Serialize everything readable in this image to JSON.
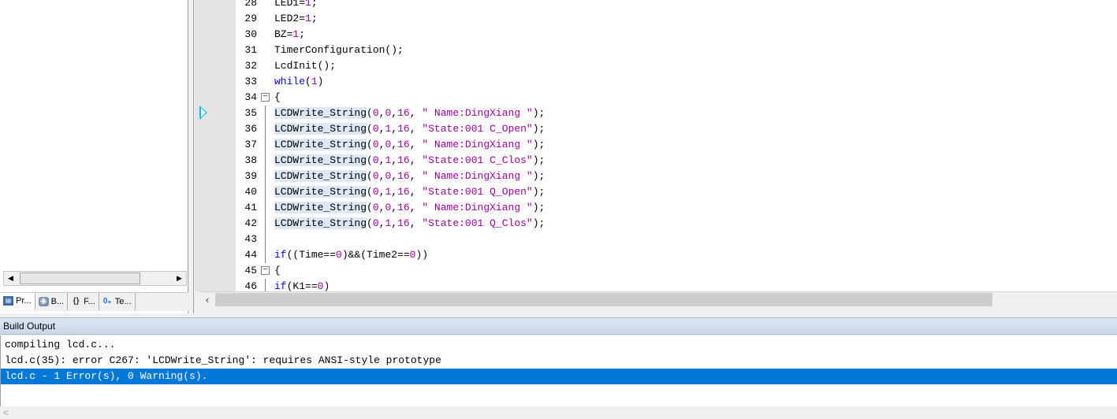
{
  "editor": {
    "lines": [
      {
        "num": "28",
        "code": [
          {
            "t": "LED1="
          },
          {
            "t": "1",
            "c": "num"
          },
          {
            "t": ";"
          }
        ]
      },
      {
        "num": "29",
        "code": [
          {
            "t": "LED2="
          },
          {
            "t": "1",
            "c": "num"
          },
          {
            "t": ";"
          }
        ]
      },
      {
        "num": "30",
        "code": [
          {
            "t": "BZ="
          },
          {
            "t": "1",
            "c": "num"
          },
          {
            "t": ";"
          }
        ]
      },
      {
        "num": "31",
        "code": [
          {
            "t": "TimerConfiguration();"
          }
        ]
      },
      {
        "num": "32",
        "code": [
          {
            "t": "LcdInit();"
          }
        ]
      },
      {
        "num": "33",
        "code": [
          {
            "t": "while",
            "c": "kw"
          },
          {
            "t": "("
          },
          {
            "t": "1",
            "c": "num"
          },
          {
            "t": ")"
          }
        ]
      },
      {
        "num": "34",
        "fold": "−",
        "code": [
          {
            "t": "{"
          }
        ]
      },
      {
        "num": "35",
        "code": [
          {
            "t": "LCDWrite_String",
            "c": "hl"
          },
          {
            "t": "("
          },
          {
            "t": "0",
            "c": "num"
          },
          {
            "t": ","
          },
          {
            "t": "0",
            "c": "num"
          },
          {
            "t": ","
          },
          {
            "t": "16",
            "c": "num"
          },
          {
            "t": ", "
          },
          {
            "t": "\" Name:DingXiang \"",
            "c": "str"
          },
          {
            "t": ");"
          }
        ]
      },
      {
        "num": "36",
        "code": [
          {
            "t": "LCDWrite_String",
            "c": "hl"
          },
          {
            "t": "("
          },
          {
            "t": "0",
            "c": "num"
          },
          {
            "t": ","
          },
          {
            "t": "1",
            "c": "num"
          },
          {
            "t": ","
          },
          {
            "t": "16",
            "c": "num"
          },
          {
            "t": ", "
          },
          {
            "t": "\"State:001 C_Open\"",
            "c": "str"
          },
          {
            "t": ");"
          }
        ]
      },
      {
        "num": "37",
        "code": [
          {
            "t": "LCDWrite_String",
            "c": "hl"
          },
          {
            "t": "("
          },
          {
            "t": "0",
            "c": "num"
          },
          {
            "t": ","
          },
          {
            "t": "0",
            "c": "num"
          },
          {
            "t": ","
          },
          {
            "t": "16",
            "c": "num"
          },
          {
            "t": ", "
          },
          {
            "t": "\" Name:DingXiang \"",
            "c": "str"
          },
          {
            "t": ");"
          }
        ]
      },
      {
        "num": "38",
        "code": [
          {
            "t": "LCDWrite_String",
            "c": "hl"
          },
          {
            "t": "("
          },
          {
            "t": "0",
            "c": "num"
          },
          {
            "t": ","
          },
          {
            "t": "1",
            "c": "num"
          },
          {
            "t": ","
          },
          {
            "t": "16",
            "c": "num"
          },
          {
            "t": ", "
          },
          {
            "t": "\"State:001 C_Clos\"",
            "c": "str"
          },
          {
            "t": ");"
          }
        ]
      },
      {
        "num": "39",
        "code": [
          {
            "t": "LCDWrite_String",
            "c": "hl"
          },
          {
            "t": "("
          },
          {
            "t": "0",
            "c": "num"
          },
          {
            "t": ","
          },
          {
            "t": "0",
            "c": "num"
          },
          {
            "t": ","
          },
          {
            "t": "16",
            "c": "num"
          },
          {
            "t": ", "
          },
          {
            "t": "\" Name:DingXiang \"",
            "c": "str"
          },
          {
            "t": ");"
          }
        ]
      },
      {
        "num": "40",
        "code": [
          {
            "t": "LCDWrite_String",
            "c": "hl"
          },
          {
            "t": "("
          },
          {
            "t": "0",
            "c": "num"
          },
          {
            "t": ","
          },
          {
            "t": "1",
            "c": "num"
          },
          {
            "t": ","
          },
          {
            "t": "16",
            "c": "num"
          },
          {
            "t": ", "
          },
          {
            "t": "\"State:001 Q_Open\"",
            "c": "str"
          },
          {
            "t": ");"
          }
        ]
      },
      {
        "num": "41",
        "code": [
          {
            "t": "LCDWrite_String",
            "c": "hl"
          },
          {
            "t": "("
          },
          {
            "t": "0",
            "c": "num"
          },
          {
            "t": ","
          },
          {
            "t": "0",
            "c": "num"
          },
          {
            "t": ","
          },
          {
            "t": "16",
            "c": "num"
          },
          {
            "t": ", "
          },
          {
            "t": "\" Name:DingXiang \"",
            "c": "str"
          },
          {
            "t": ");"
          }
        ]
      },
      {
        "num": "42",
        "code": [
          {
            "t": "LCDWrite_String",
            "c": "hl"
          },
          {
            "t": "("
          },
          {
            "t": "0",
            "c": "num"
          },
          {
            "t": ","
          },
          {
            "t": "1",
            "c": "num"
          },
          {
            "t": ","
          },
          {
            "t": "16",
            "c": "num"
          },
          {
            "t": ", "
          },
          {
            "t": "\"State:001 Q_Clos\"",
            "c": "str"
          },
          {
            "t": ");"
          }
        ]
      },
      {
        "num": "43",
        "code": []
      },
      {
        "num": "44",
        "code": [
          {
            "t": "if",
            "c": "kw"
          },
          {
            "t": "((Time=="
          },
          {
            "t": "0",
            "c": "num"
          },
          {
            "t": ")&&(Time2=="
          },
          {
            "t": "0",
            "c": "num"
          },
          {
            "t": "))"
          }
        ]
      },
      {
        "num": "45",
        "fold": "−",
        "code": [
          {
            "t": "{"
          }
        ]
      },
      {
        "num": "46",
        "code": [
          {
            "t": "if",
            "c": "kw"
          },
          {
            "t": "(K1=="
          },
          {
            "t": "0",
            "c": "num"
          },
          {
            "t": ")"
          }
        ]
      }
    ]
  },
  "project_tabs": [
    {
      "label": "Pr...",
      "icon": "project-icon",
      "glyph": "▤"
    },
    {
      "label": "B...",
      "icon": "books-icon",
      "glyph": "◉"
    },
    {
      "label": "F...",
      "icon": "functions-icon",
      "glyph": "{}"
    },
    {
      "label": "Te...",
      "icon": "templates-icon",
      "glyph": "0₊"
    }
  ],
  "build_output": {
    "title": "Build Output",
    "lines": [
      "compiling lcd.c...",
      "lcd.c(35): error C267: 'LCDWrite_String': requires ANSI-style prototype",
      "lcd.c - 1 Error(s), 0 Warning(s)."
    ],
    "selected_index": 2
  },
  "colors": {
    "selection": "#0078d7",
    "keyword": "#0000ff",
    "number_string": "#9a009a",
    "exec_arrow": "#00bfff"
  }
}
